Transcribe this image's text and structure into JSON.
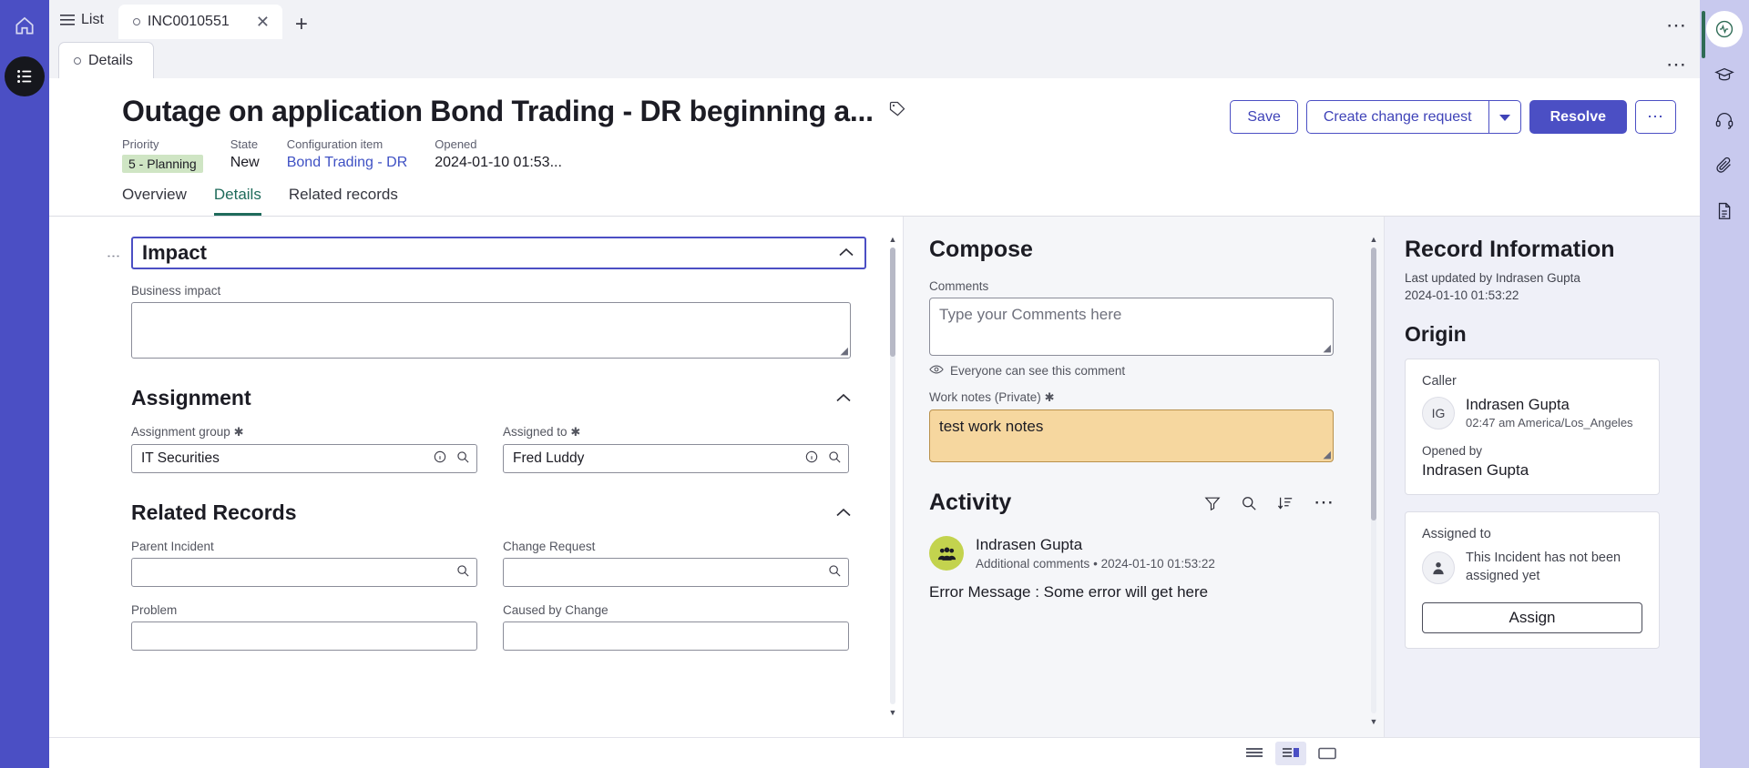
{
  "left_rail": {
    "home_icon": "home-icon",
    "menu_icon": "all-menu-icon"
  },
  "tabbar": {
    "list_label": "List",
    "list_icon": "list-icon",
    "record_tab_label": "INC0010551",
    "close_icon": "close-icon",
    "new_tab_icon": "plus-icon",
    "more_icon": "more-horizontal-icon"
  },
  "subtabbar": {
    "details_label": "Details",
    "more_icon": "more-horizontal-icon"
  },
  "record": {
    "title": "Outage on application Bond Trading - DR beginning a...",
    "tag_icon": "tag-icon",
    "meta": [
      {
        "label": "Priority",
        "value": "5 - Planning",
        "style": "badge"
      },
      {
        "label": "State",
        "value": "New",
        "style": "plain"
      },
      {
        "label": "Configuration item",
        "value": "Bond Trading - DR",
        "style": "link"
      },
      {
        "label": "Opened",
        "value": "2024-01-10 01:53...",
        "style": "plain"
      }
    ],
    "actions": {
      "save_label": "Save",
      "create_change_label": "Create change request",
      "create_change_caret_icon": "chevron-down-icon",
      "resolve_label": "Resolve",
      "more_icon": "more-horizontal-icon"
    },
    "tabs": [
      {
        "label": "Overview",
        "active": false
      },
      {
        "label": "Details",
        "active": true
      },
      {
        "label": "Related records",
        "active": false
      }
    ]
  },
  "form": {
    "drag_handle_icon": "drag-handle-icon",
    "sections": [
      {
        "title": "Impact",
        "collapse_icon": "chevron-up-icon",
        "selected": true,
        "fields": [
          {
            "label": "Business impact",
            "value": "",
            "type": "textarea",
            "required": false
          }
        ]
      },
      {
        "title": "Assignment",
        "collapse_icon": "chevron-up-icon",
        "selected": false,
        "fields": [
          {
            "label": "Assignment group",
            "value": "IT Securities",
            "type": "reference",
            "required": true,
            "icons": [
              "info-icon",
              "search-icon"
            ]
          },
          {
            "label": "Assigned to",
            "value": "Fred Luddy",
            "type": "reference",
            "required": true,
            "icons": [
              "info-icon",
              "search-icon"
            ]
          }
        ]
      },
      {
        "title": "Related Records",
        "collapse_icon": "chevron-up-icon",
        "selected": false,
        "fields": [
          {
            "label": "Parent Incident",
            "value": "",
            "type": "reference",
            "required": false,
            "icons": [
              "search-icon"
            ]
          },
          {
            "label": "Change Request",
            "value": "",
            "type": "reference",
            "required": false,
            "icons": [
              "search-icon"
            ]
          },
          {
            "label": "Problem",
            "value": "",
            "type": "reference",
            "required": false,
            "icons": []
          },
          {
            "label": "Caused by Change",
            "value": "",
            "type": "reference",
            "required": false,
            "icons": []
          }
        ]
      }
    ],
    "scroll_up_icon": "chevron-up-icon",
    "scroll_down_icon": "chevron-down-icon"
  },
  "compose": {
    "heading": "Compose",
    "comments_label": "Comments",
    "comments_value": "",
    "comments_placeholder": "Type your Comments here",
    "visibility_icon": "eye-icon",
    "visibility_text": "Everyone can see this comment",
    "worknotes_label": "Work notes (Private)",
    "worknotes_required": true,
    "worknotes_value": "test work notes",
    "resize_icon": "resize-grip-icon"
  },
  "activity": {
    "heading": "Activity",
    "tools": [
      {
        "icon": "filter-icon",
        "name": "filter"
      },
      {
        "icon": "search-icon",
        "name": "search"
      },
      {
        "icon": "sort-icon",
        "name": "sort"
      },
      {
        "icon": "more-horizontal-icon",
        "name": "more"
      }
    ],
    "entries": [
      {
        "avatar_icon": "group-avatar-icon",
        "avatar_color": "#c3d34e",
        "author": "Indrasen Gupta",
        "type": "Additional comments",
        "separator": "•",
        "timestamp": "2024-01-10 01:53:22",
        "body": "Error Message : Some error will get here"
      }
    ]
  },
  "record_info": {
    "heading": "Record Information",
    "last_updated_by": "Last updated by Indrasen Gupta",
    "last_updated_at": "2024-01-10 01:53:22",
    "origin_heading": "Origin",
    "caller": {
      "label": "Caller",
      "initials": "IG",
      "name": "Indrasen Gupta",
      "local_time": "02:47 am America/Los_Angeles",
      "opened_by_label": "Opened by",
      "opened_by_name": "Indrasen Gupta"
    },
    "assigned": {
      "label": "Assigned to",
      "avatar_icon": "user-icon",
      "text": "This Incident has not been assigned yet",
      "button_label": "Assign"
    }
  },
  "right_rail": {
    "icons": [
      {
        "name": "activity-pulse-icon",
        "active": true
      },
      {
        "name": "graduation-cap-icon",
        "active": false
      },
      {
        "name": "headset-icon",
        "active": false
      },
      {
        "name": "paperclip-icon",
        "active": false
      },
      {
        "name": "document-icon",
        "active": false
      }
    ]
  },
  "bottombar": {
    "views": [
      {
        "name": "list-view-icon",
        "active": false
      },
      {
        "name": "split-view-icon",
        "active": true
      },
      {
        "name": "full-view-icon",
        "active": false
      }
    ]
  },
  "colors": {
    "brand_purple": "#4b4fc4",
    "rail_purple": "#c8c9ee",
    "tab_active_teal": "#1f6b5b",
    "priority_badge_green": "#cfe5c4",
    "worknotes_amber": "#f6d79f",
    "activity_avatar_green": "#c3d34e"
  }
}
